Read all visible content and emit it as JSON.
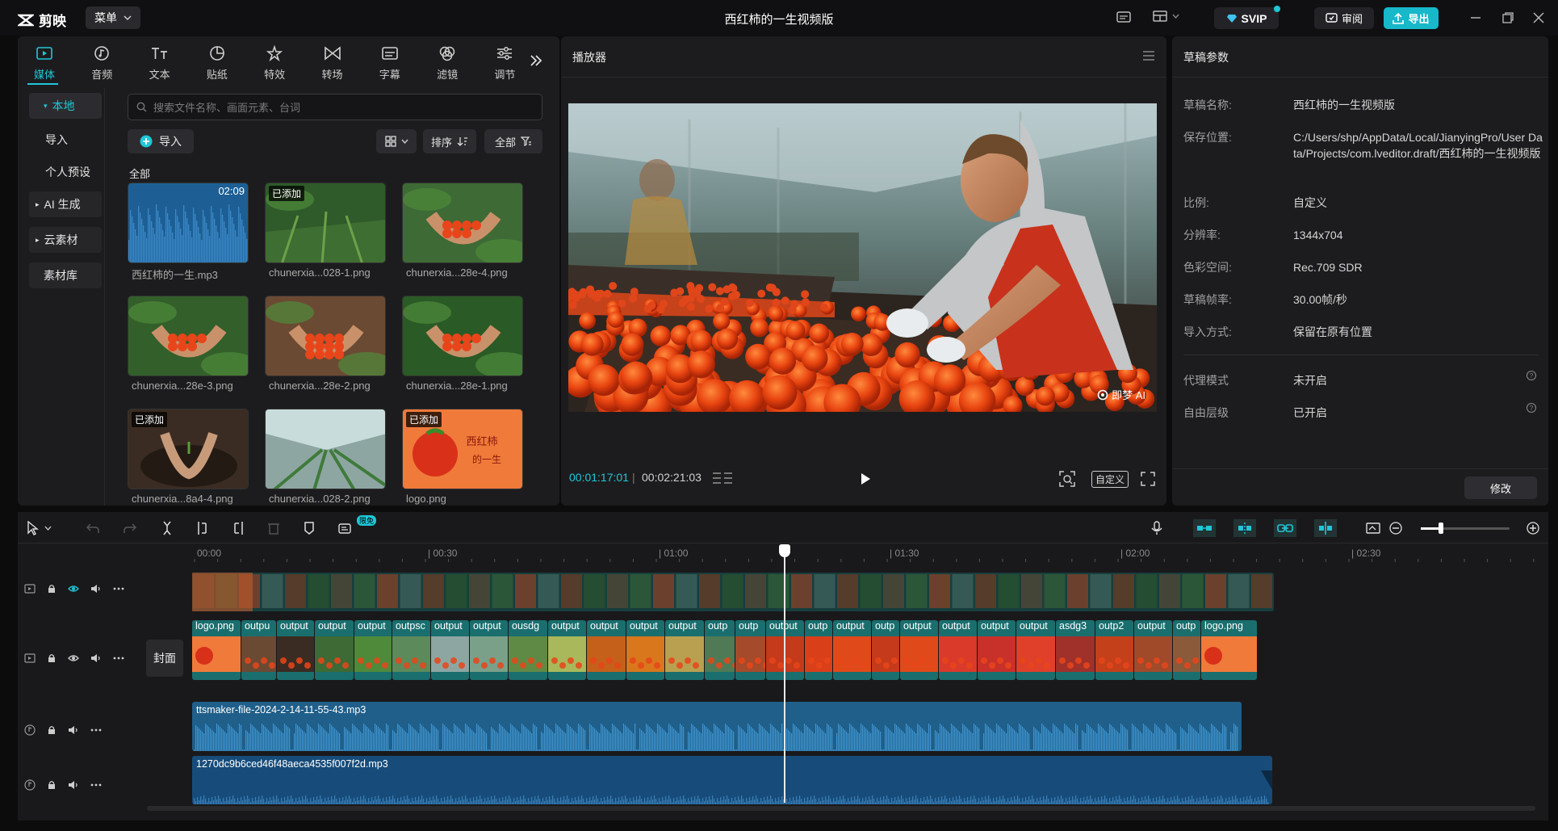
{
  "app": {
    "name": "剪映",
    "menu_label": "菜单",
    "title": "西红柿的一生视频版",
    "svip_label": "SVIP",
    "review_label": "审阅",
    "export_label": "导出"
  },
  "media_tabs": [
    {
      "label": "媒体",
      "icon": "media-icon",
      "active": true
    },
    {
      "label": "音频",
      "icon": "audio-icon"
    },
    {
      "label": "文本",
      "icon": "text-icon"
    },
    {
      "label": "贴纸",
      "icon": "sticker-icon"
    },
    {
      "label": "特效",
      "icon": "effects-icon"
    },
    {
      "label": "转场",
      "icon": "transition-icon"
    },
    {
      "label": "字幕",
      "icon": "subtitle-icon"
    },
    {
      "label": "滤镜",
      "icon": "filter-icon"
    },
    {
      "label": "调节",
      "icon": "adjust-icon"
    }
  ],
  "sidebar": {
    "local": "本地",
    "import": "导入",
    "personal_preset": "个人预设",
    "ai_gen": "AI 生成",
    "cloud": "云素材",
    "library": "素材库"
  },
  "media": {
    "search_placeholder": "搜索文件名称、画面元素、台词",
    "import_label": "导入",
    "sort_label": "排序",
    "filter_label": "全部",
    "section_label": "全部",
    "added_badge": "已添加",
    "items": [
      {
        "name": "西红柿的一生.mp3",
        "duration": "02:09",
        "kind": "audio"
      },
      {
        "name": "chunerxia...028-1.png",
        "added": true,
        "kind": "greens"
      },
      {
        "name": "chunerxia...28e-4.png",
        "kind": "hands"
      },
      {
        "name": "chunerxia...28e-3.png",
        "kind": "greens2"
      },
      {
        "name": "chunerxia...28e-2.png",
        "kind": "hands2"
      },
      {
        "name": "chunerxia...28e-1.png",
        "kind": "greens3"
      },
      {
        "name": "chunerxia...8a4-4.png",
        "added": true,
        "kind": "soil"
      },
      {
        "name": "chunerxia...028-2.png",
        "kind": "greenhouse"
      },
      {
        "name": "logo.png",
        "added": true,
        "kind": "logo"
      }
    ]
  },
  "player": {
    "title": "播放器",
    "watermark": "即梦 AI",
    "current_time": "00:01:17:01",
    "total_time": "00:02:21:03",
    "ratio_label": "自定义"
  },
  "draft": {
    "title": "草稿参数",
    "fields": [
      {
        "label": "草稿名称:",
        "value": "西红柿的一生视频版"
      },
      {
        "label": "保存位置:",
        "value": "C:/Users/shp/AppData/Local/JianyingPro/User Data/Projects/com.lveditor.draft/西红柿的一生视频版"
      },
      {
        "label": "比例:",
        "value": "自定义"
      },
      {
        "label": "分辨率:",
        "value": "1344x704"
      },
      {
        "label": "色彩空间:",
        "value": "Rec.709 SDR"
      },
      {
        "label": "草稿帧率:",
        "value": "30.00帧/秒"
      },
      {
        "label": "导入方式:",
        "value": "保留在原有位置"
      }
    ],
    "proxy_label": "代理模式",
    "proxy_value": "未开启",
    "layer_label": "自由层级",
    "layer_value": "已开启",
    "modify_label": "修改"
  },
  "timeline": {
    "free_badge": "限免",
    "cover_label": "封面",
    "ruler": [
      "00:00",
      "00:30",
      "01:00",
      "01:30",
      "02:00",
      "02:30"
    ],
    "video_clips": [
      "logo.png",
      "outpu",
      "output",
      "output",
      "output",
      "outpsc",
      "output",
      "output",
      "ousdg",
      "output",
      "output",
      "output",
      "output",
      "outp",
      "outp",
      "output",
      "outp",
      "output",
      "outp",
      "output",
      "output",
      "output",
      "output",
      "asdg3",
      "outp2",
      "output",
      "outp",
      "logo.png"
    ],
    "audio1": "ttsmaker-file-2024-2-14-11-55-43.mp3",
    "audio2": "1270dc9b6ced46f48aeca4535f007f2d.mp3"
  },
  "colors": {
    "accent": "#1fc7d8",
    "clip_teal": "#1a6e6e",
    "audio_blue": "#1e6a9a"
  }
}
